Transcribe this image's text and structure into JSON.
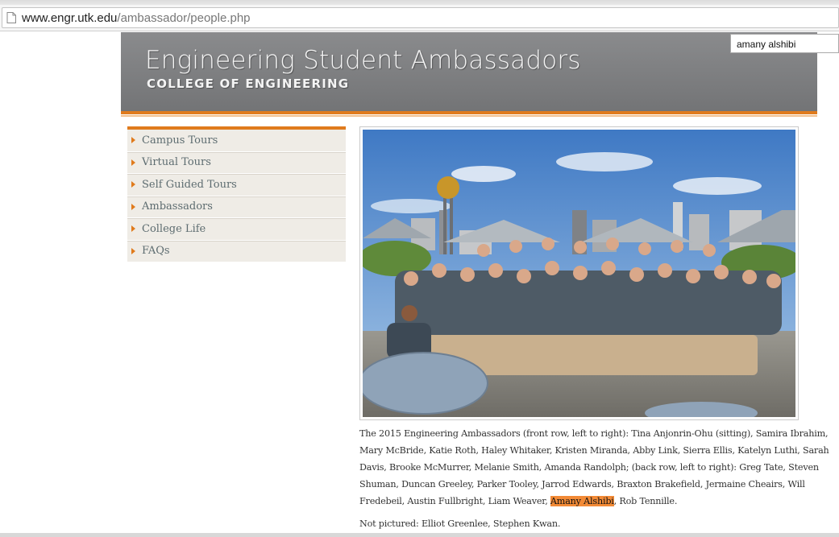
{
  "browser": {
    "url_host": "www.engr.utk.edu",
    "url_path": "/ambassador/people.php",
    "find_query": "amany alshibi"
  },
  "header": {
    "title": "Engineering Student Ambassadors",
    "subtitle": "COLLEGE OF ENGINEERING",
    "accent_color": "#e07b1d"
  },
  "nav": {
    "items": [
      {
        "label": "Campus Tours"
      },
      {
        "label": "Virtual Tours"
      },
      {
        "label": "Self Guided Tours"
      },
      {
        "label": "Ambassadors"
      },
      {
        "label": "College Life"
      },
      {
        "label": "FAQs"
      }
    ]
  },
  "caption": {
    "lines": [
      "The 2015 Engineering Ambassadors (front row, left to right): Tina Anjonrin-Ohu (sitting), Samira Ibrahim,",
      "Mary McBride, Katie Roth, Haley Whitaker, Kristen Miranda, Abby Link, Sierra Ellis, Katelyn Luthi, Sarah",
      "Davis, Brooke McMurrer, Melanie Smith, Amanda Randolph; (back row, left to right): Greg Tate, Steven",
      "Shuman, Duncan Greeley, Parker Tooley, Jarrod Edwards, Braxton Brakefield, Jermaine Cheairs, Will"
    ],
    "last_line_before": "Fredebeil, Austin Fullbright, Liam Weaver, ",
    "highlight": "Amany Alshibi",
    "last_line_after": ", Rob Tennille.",
    "not_pictured": "Not pictured: Elliot Greenlee, Stephen Kwan."
  }
}
